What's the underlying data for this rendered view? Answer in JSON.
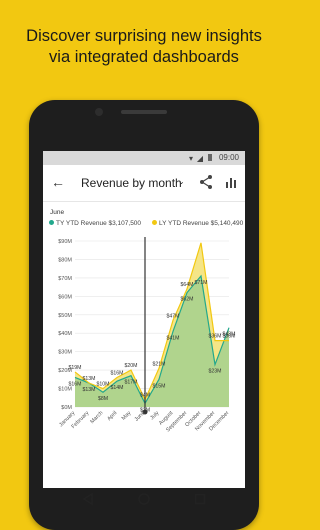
{
  "headline": {
    "line1": "Discover surprising new insights",
    "line2": "via integrated dashboards"
  },
  "status_bar": {
    "time": "09:00"
  },
  "app_bar": {
    "title": "Revenue by month",
    "icons": [
      "back-arrow-icon",
      "chevron-down-icon",
      "share-icon",
      "bar-chart-icon"
    ]
  },
  "selection": {
    "label": "June"
  },
  "legend": {
    "ty": "TY YTD Revenue $3,107,500",
    "ly": "LY YTD Revenue $5,140,490"
  },
  "colors": {
    "background": "#F2C811",
    "ty_series": "#22A88C",
    "ly_series": "#F2C811",
    "ty_fill": "#A9D18E",
    "ly_fill": "#F4E27A"
  },
  "chart_data": {
    "type": "area",
    "categories": [
      "January",
      "February",
      "March",
      "April",
      "May",
      "June",
      "July",
      "August",
      "September",
      "October",
      "November",
      "December"
    ],
    "ylim": [
      0,
      90
    ],
    "yticks": [
      "$0M",
      "$10M",
      "$20M",
      "$30M",
      "$40M",
      "$50M",
      "$60M",
      "$70M",
      "$80M",
      "$90M"
    ],
    "series": [
      {
        "name": "TY YTD Revenue",
        "values": [
          16,
          13,
          8,
          14,
          17,
          2,
          15,
          41,
          62,
          71,
          23,
          43
        ],
        "labels": [
          "$16M",
          "$13M",
          "$8M",
          "$14M",
          "$17M",
          "$2M",
          "$15M",
          "$41M",
          "$62M",
          "$71M",
          "$23M",
          "$43M"
        ]
      },
      {
        "name": "LY YTD Revenue",
        "values": [
          19,
          13,
          10,
          16,
          20,
          4,
          21,
          47,
          64,
          89,
          36,
          36
        ],
        "labels": [
          "$19M",
          "$13M",
          "$10M",
          "$16M",
          "$20M",
          "$4M",
          "$21M",
          "$47M",
          "$64M",
          "",
          "$36M",
          "$36M"
        ]
      }
    ],
    "selected_index": 5,
    "grid": true
  },
  "nav_bar": {
    "icons": [
      "back-triangle-icon",
      "home-circle-icon",
      "recents-square-icon"
    ]
  }
}
